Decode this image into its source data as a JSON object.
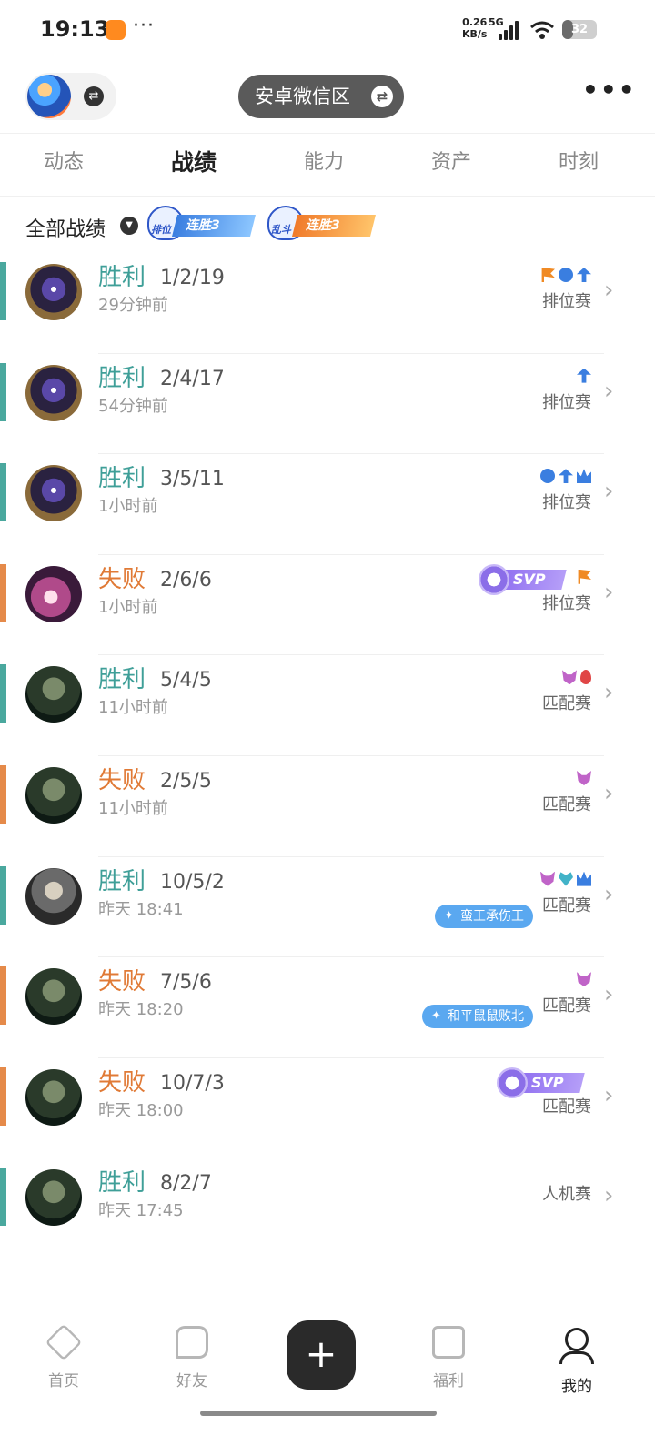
{
  "status": {
    "time": "19:13",
    "more": "···",
    "net_speed_value": "0.26",
    "net_speed_unit": "KB/s",
    "network": "5G",
    "battery": "32"
  },
  "header": {
    "server": "安卓微信区",
    "more": "•••"
  },
  "tabs": [
    "动态",
    "战绩",
    "能力",
    "资产",
    "时刻"
  ],
  "active_tab": "战绩",
  "filter": {
    "label": "全部战绩",
    "streaks": [
      {
        "category": "排位",
        "label": "连胜3"
      },
      {
        "category": "乱斗",
        "label": "连胜3"
      }
    ]
  },
  "colors": {
    "win": "#3f9f98",
    "loss": "#e07a36",
    "win_bar": "#4aa89e",
    "loss_bar": "#e58a4a"
  },
  "matches": [
    {
      "result": "胜利",
      "outcome": "win",
      "kda": "1/2/19",
      "time": "29分钟前",
      "mode": "排位赛",
      "medals": [
        "flag-icon",
        "shield-icon",
        "tree-icon"
      ]
    },
    {
      "result": "胜利",
      "outcome": "win",
      "kda": "2/4/17",
      "time": "54分钟前",
      "mode": "排位赛",
      "medals": [
        "tree-icon"
      ]
    },
    {
      "result": "胜利",
      "outcome": "win",
      "kda": "3/5/11",
      "time": "1小时前",
      "mode": "排位赛",
      "medals": [
        "shield-icon",
        "tree-icon",
        "crown-icon"
      ]
    },
    {
      "result": "失败",
      "outcome": "loss",
      "kda": "2/6/6",
      "time": "1小时前",
      "mode": "排位赛",
      "svp": "SVP",
      "medals": [
        "flag-icon"
      ]
    },
    {
      "result": "胜利",
      "outcome": "win",
      "kda": "5/4/5",
      "time": "11小时前",
      "mode": "匹配赛",
      "medals": [
        "demon-icon",
        "blood-icon"
      ]
    },
    {
      "result": "失败",
      "outcome": "loss",
      "kda": "2/5/5",
      "time": "11小时前",
      "mode": "匹配赛",
      "medals": [
        "demon-icon"
      ]
    },
    {
      "result": "胜利",
      "outcome": "win",
      "kda": "10/5/2",
      "time": "昨天 18:41",
      "mode": "匹配赛",
      "achievement": "蛮王承伤王",
      "medals": [
        "demon-icon",
        "heart-icon",
        "crown-icon"
      ]
    },
    {
      "result": "失败",
      "outcome": "loss",
      "kda": "7/5/6",
      "time": "昨天 18:20",
      "mode": "匹配赛",
      "achievement": "和平鼠鼠败北",
      "medals": [
        "demon-icon"
      ]
    },
    {
      "result": "失败",
      "outcome": "loss",
      "kda": "10/7/3",
      "time": "昨天 18:00",
      "mode": "匹配赛",
      "svp": "SVP",
      "medals": []
    },
    {
      "result": "胜利",
      "outcome": "win",
      "kda": "8/2/7",
      "time": "昨天 17:45",
      "mode": "人机赛",
      "medals": []
    }
  ],
  "nav": {
    "items": [
      {
        "label": "首页",
        "icon": "home-icon"
      },
      {
        "label": "好友",
        "icon": "chat-icon"
      },
      {
        "label": "福利",
        "icon": "gift-icon"
      },
      {
        "label": "我的",
        "icon": "profile-icon"
      }
    ],
    "plus": "+"
  }
}
